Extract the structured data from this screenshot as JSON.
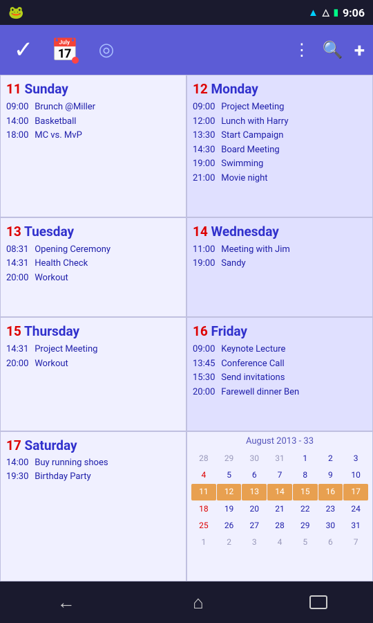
{
  "statusBar": {
    "time": "9:06",
    "androidIcon": "🐸"
  },
  "appBar": {
    "icons": [
      "✓",
      "📅",
      "◎"
    ],
    "rightIcons": [
      "⋮",
      "🔍",
      "+"
    ]
  },
  "days": [
    {
      "id": "sunday-11",
      "dayNum": "11",
      "dayName": "Sunday",
      "events": [
        {
          "time": "09:00",
          "title": "Brunch @Miller"
        },
        {
          "time": "14:00",
          "title": "Basketball"
        },
        {
          "time": "18:00",
          "title": "MC vs. MvP"
        }
      ]
    },
    {
      "id": "monday-12",
      "dayNum": "12",
      "dayName": "Monday",
      "events": [
        {
          "time": "09:00",
          "title": "Project Meeting"
        },
        {
          "time": "12:00",
          "title": "Lunch with Harry"
        },
        {
          "time": "13:30",
          "title": "Start Campaign"
        },
        {
          "time": "14:30",
          "title": "Board Meeting"
        },
        {
          "time": "19:00",
          "title": "Swimming"
        },
        {
          "time": "21:00",
          "title": "Movie night"
        }
      ]
    },
    {
      "id": "tuesday-13",
      "dayNum": "13",
      "dayName": "Tuesday",
      "events": [
        {
          "time": "08:31",
          "title": "Opening Ceremony"
        },
        {
          "time": "14:31",
          "title": "Health Check"
        },
        {
          "time": "20:00",
          "title": "Workout"
        }
      ]
    },
    {
      "id": "wednesday-14",
      "dayNum": "14",
      "dayName": "Wednesday",
      "events": [
        {
          "time": "11:00",
          "title": "Meeting with Jim"
        },
        {
          "time": "19:00",
          "title": "Sandy"
        }
      ]
    },
    {
      "id": "thursday-15",
      "dayNum": "15",
      "dayName": "Thursday",
      "events": [
        {
          "time": "14:31",
          "title": "Project Meeting"
        },
        {
          "time": "20:00",
          "title": "Workout"
        }
      ]
    },
    {
      "id": "friday-16",
      "dayNum": "16",
      "dayName": "Friday",
      "events": [
        {
          "time": "09:00",
          "title": "Keynote Lecture"
        },
        {
          "time": "13:45",
          "title": "Conference Call"
        },
        {
          "time": "15:30",
          "title": "Send invitations"
        },
        {
          "time": "20:00",
          "title": "Farewell dinner Ben"
        }
      ]
    },
    {
      "id": "saturday-17",
      "dayNum": "17",
      "dayName": "Saturday",
      "events": [
        {
          "time": "14:00",
          "title": "Buy running shoes"
        },
        {
          "time": "19:30",
          "title": "Birthday Party"
        }
      ]
    }
  ],
  "miniCalendar": {
    "header": "August 2013  -  33",
    "dayHeaders": [
      "28",
      "29",
      "30",
      "31",
      "1",
      "2",
      "3"
    ],
    "weeks": [
      [
        {
          "day": "28",
          "type": "muted"
        },
        {
          "day": "29",
          "type": "muted"
        },
        {
          "day": "30",
          "type": "muted"
        },
        {
          "day": "31",
          "type": "muted"
        },
        {
          "day": "1",
          "type": "normal"
        },
        {
          "day": "2",
          "type": "normal"
        },
        {
          "day": "3",
          "type": "normal"
        }
      ],
      [
        {
          "day": "4",
          "type": "red"
        },
        {
          "day": "5",
          "type": "normal"
        },
        {
          "day": "6",
          "type": "normal"
        },
        {
          "day": "7",
          "type": "normal"
        },
        {
          "day": "8",
          "type": "normal"
        },
        {
          "day": "9",
          "type": "normal"
        },
        {
          "day": "10",
          "type": "normal"
        }
      ],
      [
        {
          "day": "11",
          "type": "highlight"
        },
        {
          "day": "12",
          "type": "highlight"
        },
        {
          "day": "13",
          "type": "highlight"
        },
        {
          "day": "14",
          "type": "highlight"
        },
        {
          "day": "15",
          "type": "highlight"
        },
        {
          "day": "16",
          "type": "highlight"
        },
        {
          "day": "17",
          "type": "highlight"
        }
      ],
      [
        {
          "day": "18",
          "type": "red"
        },
        {
          "day": "19",
          "type": "normal"
        },
        {
          "day": "20",
          "type": "normal"
        },
        {
          "day": "21",
          "type": "normal"
        },
        {
          "day": "22",
          "type": "normal"
        },
        {
          "day": "23",
          "type": "normal"
        },
        {
          "day": "24",
          "type": "normal"
        }
      ],
      [
        {
          "day": "25",
          "type": "red"
        },
        {
          "day": "26",
          "type": "normal"
        },
        {
          "day": "27",
          "type": "normal"
        },
        {
          "day": "28",
          "type": "normal"
        },
        {
          "day": "29",
          "type": "normal"
        },
        {
          "day": "30",
          "type": "normal"
        },
        {
          "day": "31",
          "type": "normal"
        }
      ],
      [
        {
          "day": "1",
          "type": "muted"
        },
        {
          "day": "2",
          "type": "muted"
        },
        {
          "day": "3",
          "type": "muted"
        },
        {
          "day": "4",
          "type": "muted"
        },
        {
          "day": "5",
          "type": "muted"
        },
        {
          "day": "6",
          "type": "muted"
        },
        {
          "day": "7",
          "type": "muted"
        }
      ]
    ]
  },
  "bottomNav": {
    "back": "←",
    "home": "⌂",
    "recent": "▭"
  }
}
